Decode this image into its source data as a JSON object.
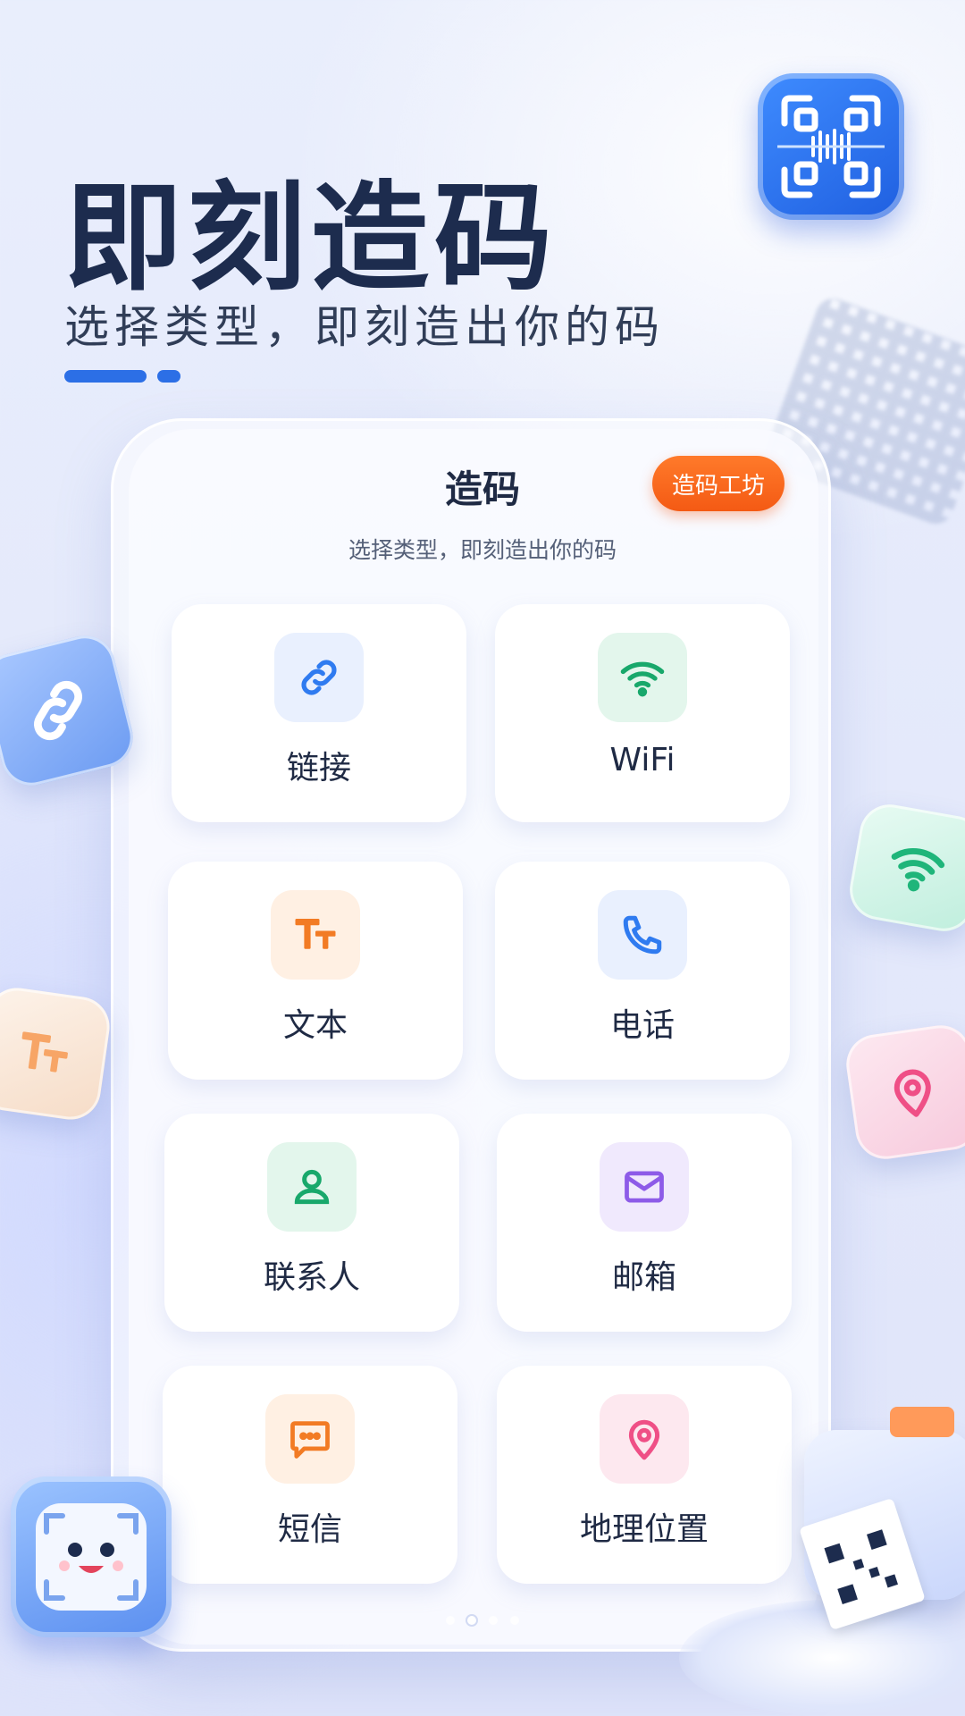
{
  "hero": {
    "title": "即刻造码",
    "subtitle": "选择类型，即刻造出你的码"
  },
  "panel": {
    "title": "造码",
    "badge": "造码工坊",
    "subtitle": "选择类型，即刻造出你的码"
  },
  "types": [
    {
      "label": "链接",
      "icon": "link-icon",
      "color": "#2f7bf0",
      "bg": "#e9f0fe"
    },
    {
      "label": "WiFi",
      "icon": "wifi-icon",
      "color": "#18a86b",
      "bg": "#e3f6ec"
    },
    {
      "label": "文本",
      "icon": "text-icon",
      "color": "#f27b24",
      "bg": "#fff0e3"
    },
    {
      "label": "电话",
      "icon": "phone-icon",
      "color": "#2f7bf0",
      "bg": "#e9f0fe"
    },
    {
      "label": "联系人",
      "icon": "contact-icon",
      "color": "#18a86b",
      "bg": "#e3f6ec"
    },
    {
      "label": "邮箱",
      "icon": "mail-icon",
      "color": "#8d5be8",
      "bg": "#f0e9fd"
    },
    {
      "label": "短信",
      "icon": "sms-icon",
      "color": "#f27b24",
      "bg": "#fff0e3"
    },
    {
      "label": "地理位置",
      "icon": "location-icon",
      "color": "#ef4f86",
      "bg": "#fde8ef"
    }
  ],
  "colors": {
    "accent": "#2c6fe6",
    "badge": "#f45a14"
  }
}
